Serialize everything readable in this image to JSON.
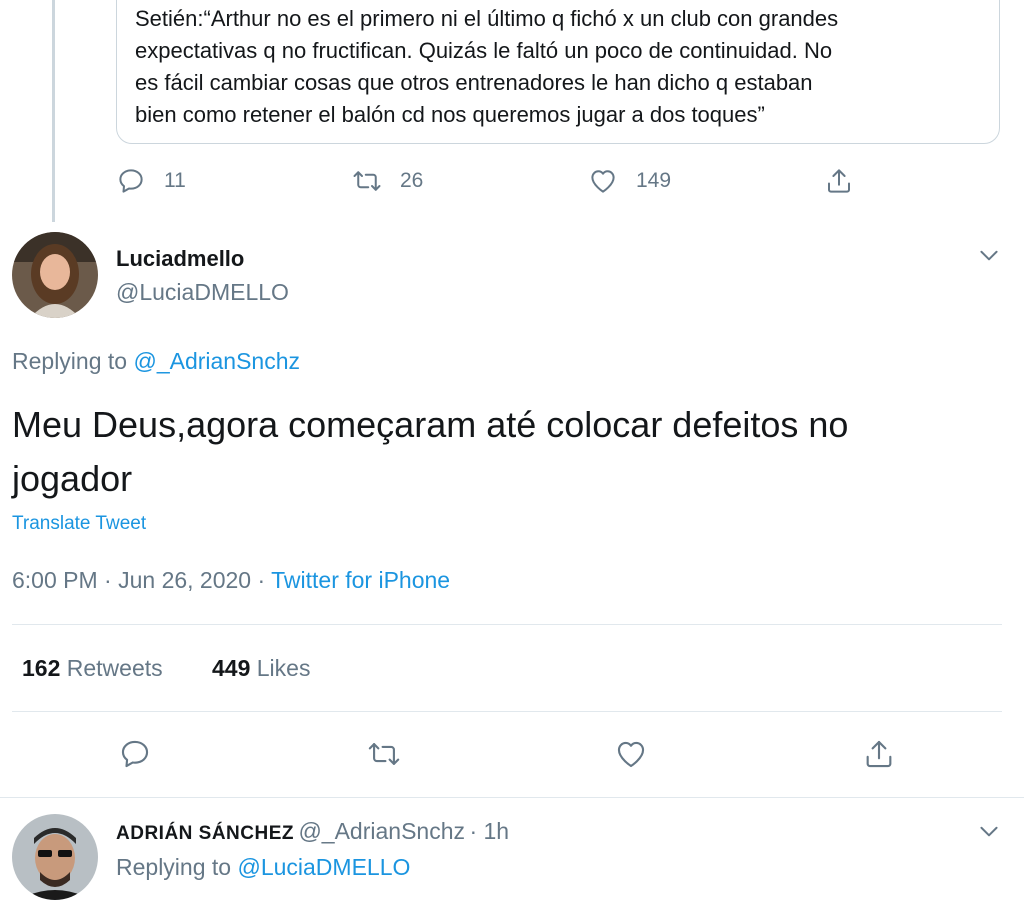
{
  "quoted_tweet": {
    "lines": [
      "Setién:“Arthur no es el primero ni el último q fichó x un club con grandes",
      "expectativas q no fructifican. Quizás le faltó un poco de continuidad. No",
      "es fácil cambiar cosas que otros entrenadores le han dicho q estaban",
      "bien como retener el balón cd nos queremos jugar a dos toques”"
    ],
    "reply_count": "11",
    "retweet_count": "26",
    "like_count": "149"
  },
  "main_tweet": {
    "display_name": "Luciadmello",
    "handle": "@LuciaDMELLO",
    "replying_prefix": "Replying to",
    "replying_to": "@_AdrianSnchz",
    "text_line1": "Meu Deus,agora começaram até colocar defeitos no",
    "text_line2": "jogador",
    "translate_label": "Translate Tweet",
    "timestamp": "6:00 PM · Jun 26, 2020 · ",
    "source": "Twitter for iPhone",
    "retweets_count": "162",
    "retweets_label": "Retweets",
    "likes_count": "449",
    "likes_label": "Likes"
  },
  "reply_tweet": {
    "display_name": "ADRIÁN SÁNCHEZ",
    "handle": "@_AdrianSnchz",
    "time": "· 1h",
    "replying_prefix": "Replying to",
    "replying_to": "@LuciaDMELLO"
  },
  "colors": {
    "link": "#1b95e0",
    "muted": "#657786",
    "border": "#e1e8ed"
  },
  "icons": [
    "reply-icon",
    "retweet-icon",
    "like-icon",
    "share-icon",
    "chevron-down-icon"
  ]
}
